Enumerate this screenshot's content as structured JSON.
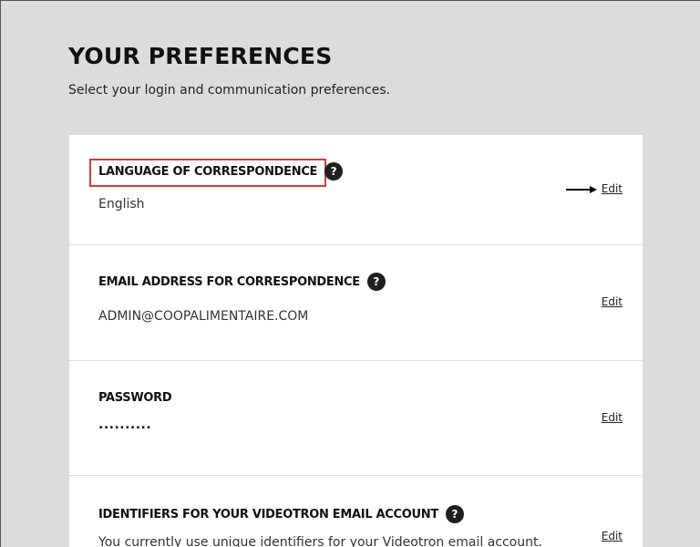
{
  "page": {
    "title": "YOUR PREFERENCES",
    "subtitle": "Select your login and communication preferences."
  },
  "sections": [
    {
      "title": "LANGUAGE OF CORRESPONDENCE",
      "value": "English",
      "edit_label": "Edit",
      "highlighted": true
    },
    {
      "title": "EMAIL ADDRESS FOR CORRESPONDENCE",
      "value": "ADMIN@COOPALIMENTAIRE.COM",
      "edit_label": "Edit"
    },
    {
      "title": "PASSWORD",
      "value": "..........",
      "edit_label": "Edit"
    },
    {
      "title": "IDENTIFIERS FOR YOUR VIDEOTRON EMAIL ACCOUNT",
      "value": "You currently use unique identifiers for your Videotron email account.",
      "edit_label": "Edit"
    }
  ],
  "icons": {
    "help": "?"
  },
  "colors": {
    "highlight_border": "#c9403f",
    "page_background": "#dcdcdc",
    "card_background": "#ffffff"
  }
}
